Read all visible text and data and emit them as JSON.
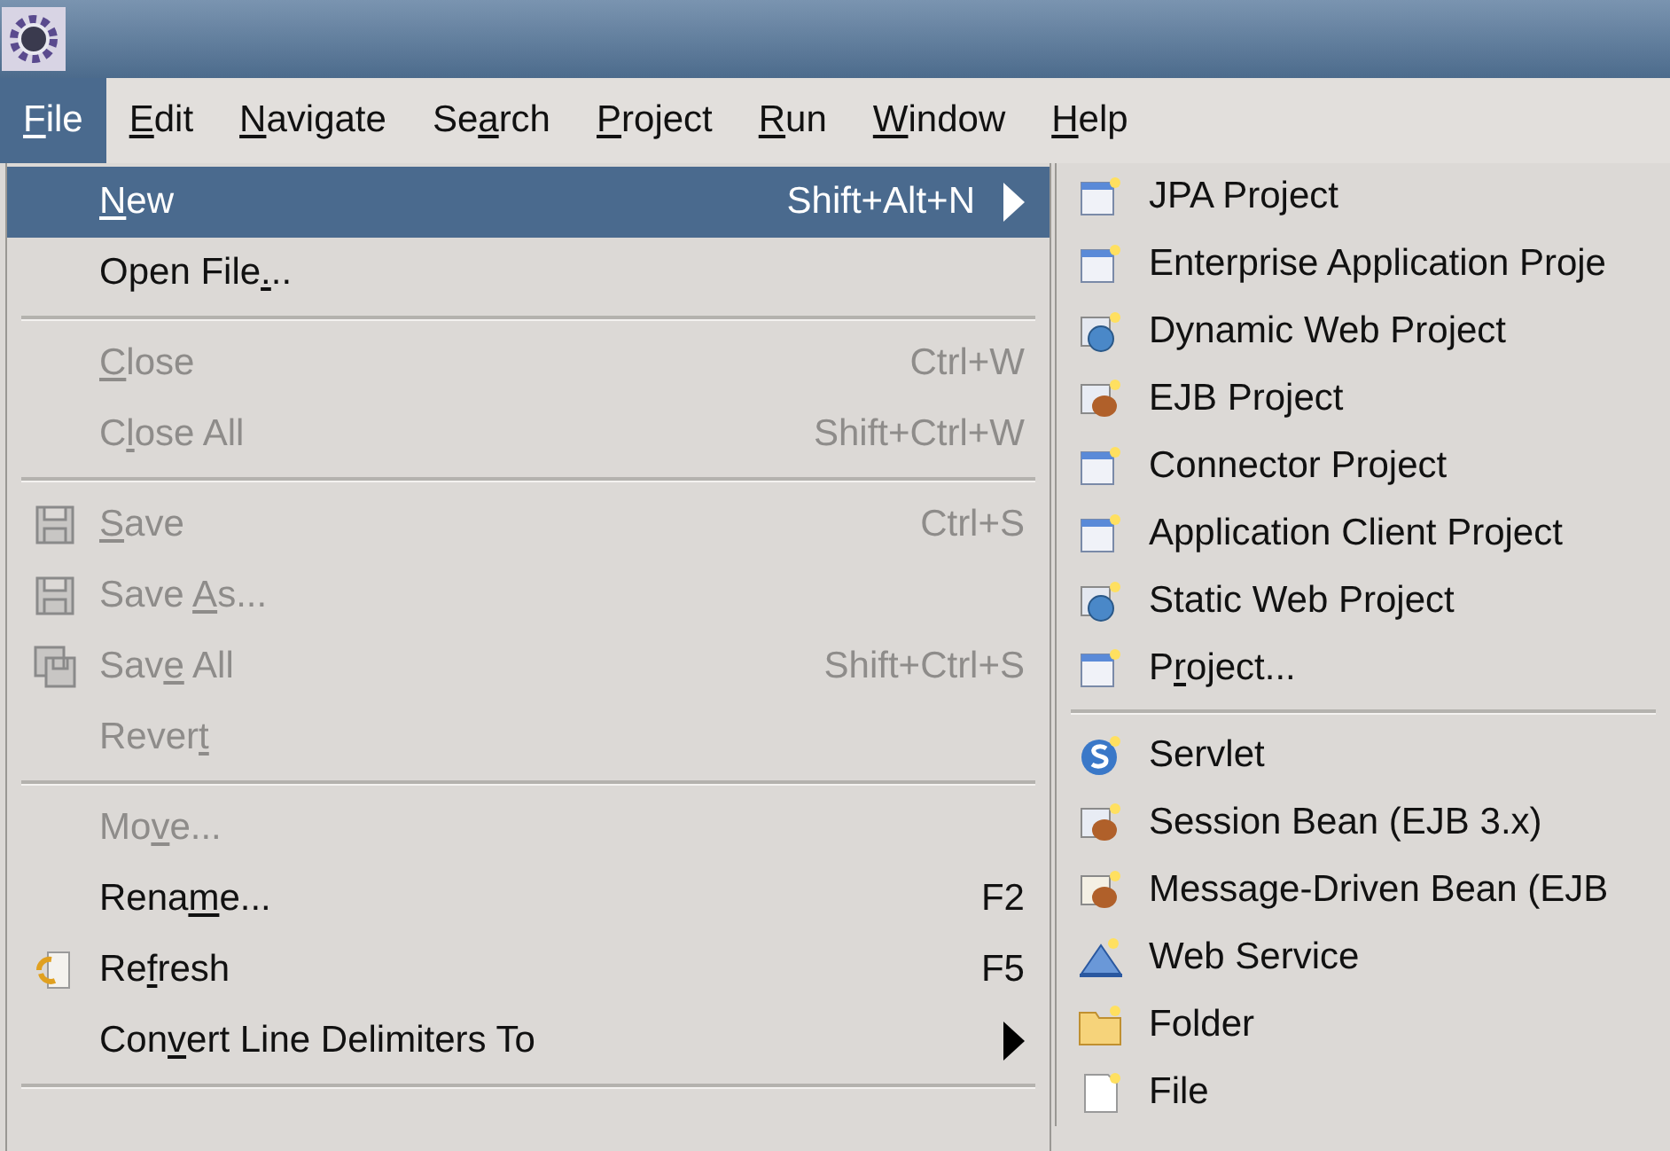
{
  "menubar": [
    {
      "label": {
        "key": "F",
        "after": "ile"
      },
      "selected": true
    },
    {
      "label": {
        "key": "E",
        "after": "dit"
      },
      "selected": false
    },
    {
      "label": {
        "key": "N",
        "after": "avigate"
      },
      "selected": false
    },
    {
      "label": {
        "before": "Se",
        "key": "a",
        "after": "rch"
      },
      "selected": false
    },
    {
      "label": {
        "key": "P",
        "after": "roject"
      },
      "selected": false
    },
    {
      "label": {
        "key": "R",
        "after": "un"
      },
      "selected": false
    },
    {
      "label": {
        "key": "W",
        "after": "indow"
      },
      "selected": false
    },
    {
      "label": {
        "key": "H",
        "after": "elp"
      },
      "selected": false
    }
  ],
  "file_menu": [
    {
      "kind": "item",
      "label": {
        "key": "N",
        "after": "ew"
      },
      "shortcut": "Shift+Alt+N",
      "submenu": true,
      "disabled": false,
      "selected": true
    },
    {
      "kind": "item",
      "label": {
        "before": "Open File",
        "key": ".",
        "after": ".."
      },
      "submenu": false,
      "disabled": false,
      "selected": false
    },
    {
      "kind": "separator"
    },
    {
      "kind": "item",
      "label": {
        "key": "C",
        "after": "lose"
      },
      "shortcut": "Ctrl+W",
      "submenu": false,
      "disabled": true,
      "selected": false
    },
    {
      "kind": "item",
      "label": {
        "before": "C",
        "key": "l",
        "after": "ose All"
      },
      "shortcut": "Shift+Ctrl+W",
      "submenu": false,
      "disabled": true,
      "selected": false
    },
    {
      "kind": "separator"
    },
    {
      "kind": "item",
      "label": {
        "key": "S",
        "after": "ave"
      },
      "shortcut": "Ctrl+S",
      "submenu": false,
      "disabled": true,
      "selected": false
    },
    {
      "kind": "item",
      "label": {
        "before": "Save ",
        "key": "A",
        "after": "s..."
      },
      "submenu": false,
      "disabled": true,
      "selected": false
    },
    {
      "kind": "item",
      "label": {
        "before": "Sav",
        "key": "e",
        "after": " All"
      },
      "shortcut": "Shift+Ctrl+S",
      "submenu": false,
      "disabled": true,
      "selected": false
    },
    {
      "kind": "item",
      "label": {
        "before": "Rever",
        "key": "t"
      },
      "submenu": false,
      "disabled": true,
      "selected": false
    },
    {
      "kind": "separator"
    },
    {
      "kind": "item",
      "label": {
        "before": "Mo",
        "key": "v",
        "after": "e..."
      },
      "submenu": false,
      "disabled": true,
      "selected": false
    },
    {
      "kind": "item",
      "label": {
        "before": "Rena",
        "key": "m",
        "after": "e..."
      },
      "shortcut": "F2",
      "submenu": false,
      "disabled": false,
      "selected": false
    },
    {
      "kind": "item",
      "label": {
        "before": "Re",
        "key": "f",
        "after": "resh"
      },
      "shortcut": "F5",
      "submenu": false,
      "disabled": false,
      "selected": false
    },
    {
      "kind": "item",
      "label": {
        "before": "Con",
        "key": "v",
        "after": "ert Line Delimiters To"
      },
      "submenu": true,
      "disabled": false,
      "selected": false
    },
    {
      "kind": "separator"
    }
  ],
  "new_submenu": [
    {
      "kind": "item",
      "label": {
        "before": "JPA Project"
      }
    },
    {
      "kind": "item",
      "label": {
        "before": "Enterprise Application Proje"
      }
    },
    {
      "kind": "item",
      "label": {
        "before": "Dynamic Web Project"
      }
    },
    {
      "kind": "item",
      "label": {
        "before": "EJB Project"
      }
    },
    {
      "kind": "item",
      "label": {
        "before": "Connector Project"
      }
    },
    {
      "kind": "item",
      "label": {
        "before": "Application Client Project"
      }
    },
    {
      "kind": "item",
      "label": {
        "before": "Static Web Project"
      }
    },
    {
      "kind": "item",
      "label": {
        "before": "P",
        "key": "r",
        "after": "oject..."
      }
    },
    {
      "kind": "separator"
    },
    {
      "kind": "item",
      "label": {
        "before": "Servlet"
      }
    },
    {
      "kind": "item",
      "label": {
        "before": "Session Bean (EJB 3.x)"
      }
    },
    {
      "kind": "item",
      "label": {
        "before": "Message-Driven Bean (EJB"
      }
    },
    {
      "kind": "item",
      "label": {
        "before": "Web Service"
      }
    },
    {
      "kind": "item",
      "label": {
        "before": "Folder"
      }
    },
    {
      "kind": "item",
      "label": {
        "before": "File"
      }
    }
  ]
}
